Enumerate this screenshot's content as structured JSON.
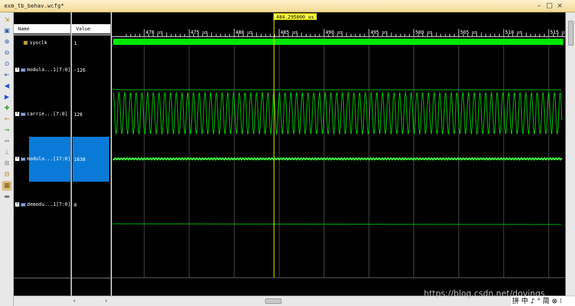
{
  "window": {
    "title": "exm_tb_behav.wcfg*",
    "controls": [
      "–",
      "□",
      "×"
    ]
  },
  "toolbar": {
    "icons": [
      "zoom-fit-icon",
      "save-icon",
      "zoom-in-icon",
      "zoom-out-icon",
      "zoom-full-icon",
      "go-start-icon",
      "prev-edge-icon",
      "next-edge-icon",
      "add-marker-icon",
      "prev-marker-icon",
      "next-marker-icon",
      "swap-cursor-icon",
      "snap-icon",
      "expand-icon",
      "collapse-icon",
      "grid-icon",
      "cursor-icon"
    ]
  },
  "columns": {
    "name": "Name",
    "value": "Value"
  },
  "signals": [
    {
      "name": "sysclk",
      "value": "1",
      "type": "clock"
    },
    {
      "name": "modula...1[7:0]",
      "value": "-126",
      "type": "bus"
    },
    {
      "name": "carrie...[7:0]",
      "value": "126",
      "type": "bus"
    },
    {
      "name": "modula...[17:0]",
      "value": "1638",
      "type": "bus",
      "selected": true
    },
    {
      "name": "demodu...1[7:0]",
      "value": "8",
      "type": "bus"
    }
  ],
  "timeline": {
    "ticks": [
      "470 us",
      "475 us",
      "480 us",
      "485 us",
      "490 us",
      "495 us",
      "500 us",
      "505 us",
      "510 us",
      "515 us"
    ],
    "cursor_label": "484.295000 us"
  },
  "colors": {
    "wave": "#00e000",
    "clock": "#00ff00",
    "cursor": "#ffff00",
    "selection": "#0a7ad8"
  },
  "watermark": "https://blog.csdn.net/dovings",
  "ime": "拼 中 ♪ ° 简 ⊗ ⁝"
}
